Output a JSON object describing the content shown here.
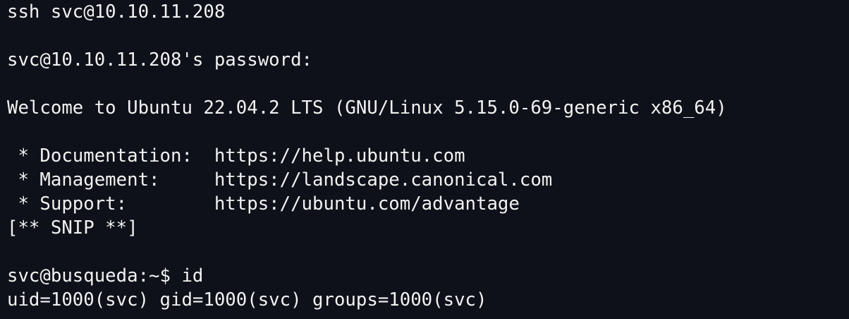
{
  "terminal": {
    "lines": [
      "ssh svc@10.10.11.208",
      "",
      "svc@10.10.11.208's password:",
      "",
      "Welcome to Ubuntu 22.04.2 LTS (GNU/Linux 5.15.0-69-generic x86_64)",
      "",
      " * Documentation:  https://help.ubuntu.com",
      " * Management:     https://landscape.canonical.com",
      " * Support:        https://ubuntu.com/advantage",
      "[** SNIP **]",
      "",
      "svc@busqueda:~$ id",
      "uid=1000(svc) gid=1000(svc) groups=1000(svc)"
    ]
  },
  "colors": {
    "background": "#0f111a",
    "foreground": "#f2f2f2"
  }
}
